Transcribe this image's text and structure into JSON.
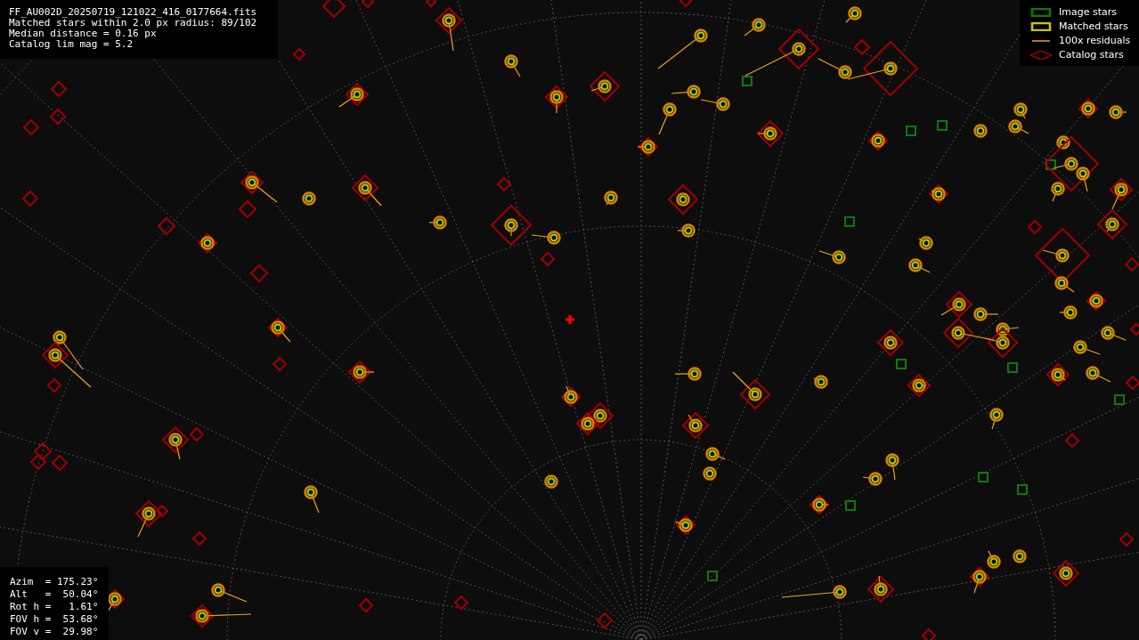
{
  "info": {
    "lines": [
      "FF_AU002D_20250719_121022_416_0177664.fits",
      "Matched stars within 2.0 px radius: 89/102",
      "Median distance = 0.16 px",
      "Catalog lim mag = 5.2"
    ]
  },
  "legend": [
    {
      "kind": "image",
      "label": "Image stars"
    },
    {
      "kind": "matched",
      "label": "Matched stars"
    },
    {
      "kind": "residual",
      "label": "100x residuals"
    },
    {
      "kind": "catalog",
      "label": "Catalog stars"
    }
  ],
  "pointing": {
    "lines": [
      "Azim  = 175.23°",
      "Alt   =  50.04°",
      "Rot h =   1.61°",
      "FOV h =  53.68°",
      "FOV v =  29.98°"
    ]
  }
}
